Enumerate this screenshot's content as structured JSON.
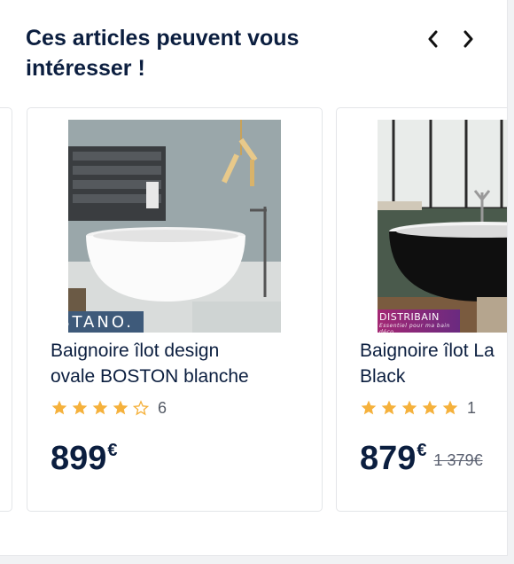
{
  "section": {
    "title": "Ces articles peuvent vous intéresser !"
  },
  "navigation": {
    "prev_icon": "chevron-left-icon",
    "next_icon": "chevron-right-icon"
  },
  "colors": {
    "title": "#0b1e3f",
    "star": "#f5b13c",
    "star_empty": "#f5b13c",
    "stano_tag": "#3e5a7a",
    "distribain_tag": "#b12771"
  },
  "products": [
    {
      "brand": "STANO.",
      "name_line1": "Baignoire îlot design",
      "name_line2": "ovale BOSTON blanche",
      "rating": 4,
      "rating_max": 5,
      "review_count": "6",
      "price_int": "899",
      "price_currency": "€"
    },
    {
      "brand": "DISTRIBAIN",
      "brand_tagline": "Essentiel pour ma bain déco",
      "name_line1": "Baignoire îlot La",
      "name_line2": "Black",
      "rating": 5,
      "rating_max": 5,
      "review_count": "1",
      "price_int": "879",
      "price_currency": "€",
      "old_price": "1 379€"
    }
  ]
}
